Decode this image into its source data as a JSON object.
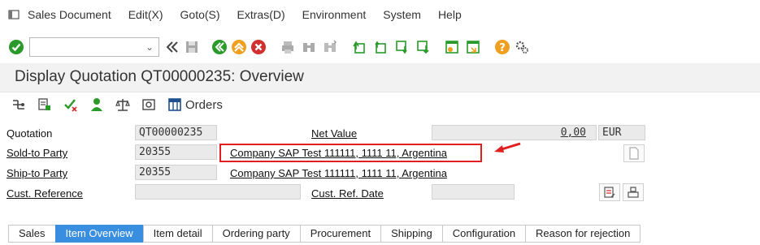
{
  "menubar": {
    "items": [
      {
        "label": "Sales Document"
      },
      {
        "label": "Edit(X)"
      },
      {
        "label": "Goto(S)"
      },
      {
        "label": "Extras(D)"
      },
      {
        "label": "Environment"
      },
      {
        "label": "System"
      },
      {
        "label": "Help"
      }
    ]
  },
  "toolbar": {
    "command_field_value": ""
  },
  "title": "Display Quotation QT00000235: Overview",
  "apptoolbar": {
    "orders_label": "Orders"
  },
  "form": {
    "quotation_label": "Quotation",
    "quotation_value": "QT00000235",
    "net_value_label": "Net Value",
    "net_value_value": "0,00",
    "currency": "EUR",
    "sold_to_label": "Sold-to Party",
    "sold_to_value": "20355",
    "sold_to_desc": "Company SAP Test 111111, 1111 11, Argentina",
    "ship_to_label": "Ship-to Party",
    "ship_to_value": "20355",
    "ship_to_desc": "Company SAP Test 111111, 1111 11, Argentina",
    "cust_ref_label": "Cust. Reference",
    "cust_ref_value": "",
    "cust_ref_date_label": "Cust. Ref. Date",
    "cust_ref_date_value": ""
  },
  "tabs": [
    {
      "label": "Sales",
      "active": false
    },
    {
      "label": "Item Overview",
      "active": true
    },
    {
      "label": "Item detail",
      "active": false
    },
    {
      "label": "Ordering party",
      "active": false
    },
    {
      "label": "Procurement",
      "active": false
    },
    {
      "label": "Shipping",
      "active": false
    },
    {
      "label": "Configuration",
      "active": false
    },
    {
      "label": "Reason for rejection",
      "active": false
    }
  ],
  "colors": {
    "accent": "#3a8ee0",
    "highlight": "#e02020",
    "ok_green": "#2a9a2a",
    "nav_orange": "#f0a020",
    "cancel_red": "#d03030"
  }
}
